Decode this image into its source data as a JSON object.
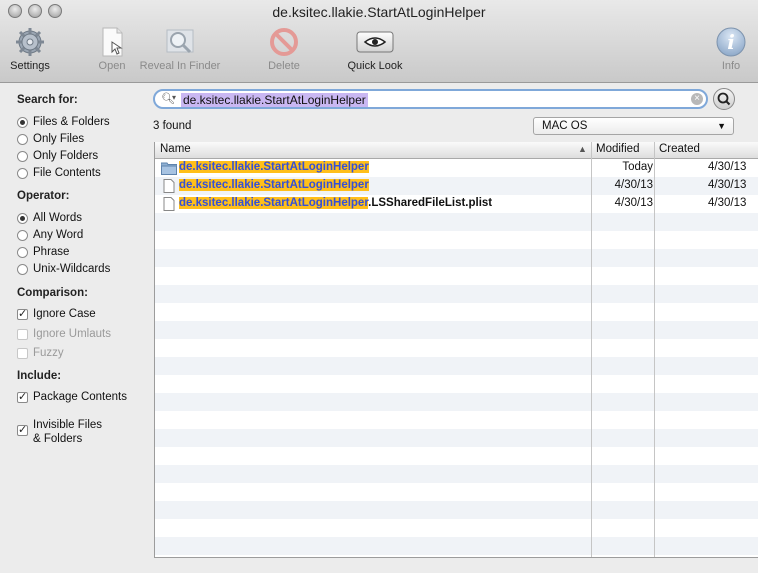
{
  "window": {
    "title": "de.ksitec.llakie.StartAtLoginHelper"
  },
  "toolbar": {
    "settings": "Settings",
    "open": "Open",
    "reveal": "Reveal In Finder",
    "delete": "Delete",
    "quicklook": "Quick Look",
    "info": "Info"
  },
  "sidebar": {
    "search_for": "Search for:",
    "search_options": [
      "Files & Folders",
      "Only Files",
      "Only Folders",
      "File Contents"
    ],
    "operator": "Operator:",
    "operator_options": [
      "All Words",
      "Any Word",
      "Phrase",
      "Unix-Wildcards"
    ],
    "comparison": "Comparison:",
    "ignore_case": "Ignore Case",
    "ignore_umlauts": "Ignore Umlauts",
    "fuzzy": "Fuzzy",
    "include": "Include:",
    "package_contents": "Package Contents",
    "invisible_line1": "Invisible Files",
    "invisible_line2": "& Folders"
  },
  "search": {
    "value": "de.ksitec.llakie.StartAtLoginHelper"
  },
  "results": {
    "count": "3 found",
    "volume": "MAC OS",
    "columns": {
      "name": "Name",
      "modified": "Modified",
      "created": "Created"
    },
    "rows": [
      {
        "match": "de.ksitec.llakie.StartAtLoginHelper",
        "suffix": "",
        "modified": "Today",
        "created": "4/30/13",
        "icon": "folder-icon"
      },
      {
        "match": "de.ksitec.llakie.StartAtLoginHelper",
        "suffix": "",
        "modified": "4/30/13",
        "created": "4/30/13",
        "icon": "document-icon"
      },
      {
        "match": "de.ksitec.llakie.StartAtLoginHelper",
        "suffix": ".LSSharedFileList.plist",
        "modified": "4/30/13",
        "created": "4/30/13",
        "icon": "document-icon"
      }
    ]
  },
  "colors": {
    "highlight": "#ffbf1a",
    "match_text": "#3550d6",
    "search_selection": "#c9b7f2",
    "focus_ring": "#7fa8d9"
  }
}
